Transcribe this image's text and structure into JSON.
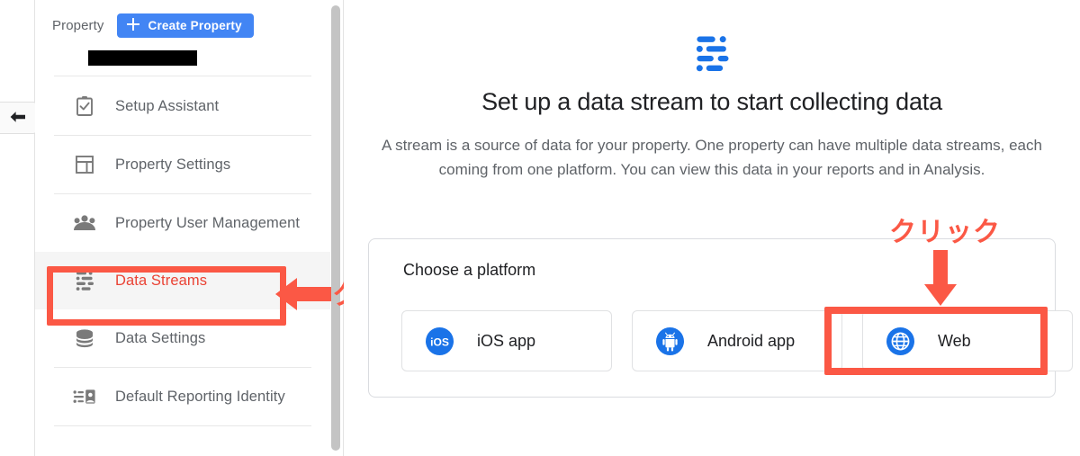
{
  "colors": {
    "brand_blue": "#4285f4",
    "icon_blue": "#1a73e8",
    "annotation_red": "#fb5845",
    "active_red": "#ea4335",
    "text_primary": "#202124",
    "text_secondary": "#5f6368"
  },
  "left_rail": {
    "collapse_icon": "back-arrow-icon"
  },
  "sidebar": {
    "section_label": "Property",
    "create_button": {
      "label": "Create Property",
      "icon": "plus-icon"
    },
    "property_name_redacted": "",
    "items": [
      {
        "label": "Setup Assistant",
        "icon": "clipboard-check-icon",
        "active": false
      },
      {
        "label": "Property Settings",
        "icon": "layout-panel-icon",
        "active": false
      },
      {
        "label": "Property User Management",
        "icon": "people-group-icon",
        "active": false
      },
      {
        "label": "Data Streams",
        "icon": "data-streams-icon",
        "active": true
      },
      {
        "label": "Data Settings",
        "icon": "database-stack-icon",
        "active": false
      },
      {
        "label": "Default Reporting Identity",
        "icon": "reporting-identity-icon",
        "active": false
      }
    ]
  },
  "main": {
    "hero_icon": "data-streams-icon",
    "title": "Set up a data stream to start collecting data",
    "description": "A stream is a source of data for your property. One property can have multiple data streams, each coming from one platform. You can view this data in your reports and in Analysis.",
    "platform_card": {
      "title": "Choose a platform",
      "options": [
        {
          "label": "iOS app",
          "icon": "ios-logo-icon"
        },
        {
          "label": "Android app",
          "icon": "android-logo-icon"
        },
        {
          "label": "Web",
          "icon": "globe-icon",
          "highlighted": true
        }
      ]
    }
  },
  "annotations": [
    {
      "text": "クリック",
      "target": "Data Streams",
      "arrow": "left-arrow-icon"
    },
    {
      "text": "クリック",
      "target": "Web",
      "arrow": "down-arrow-icon"
    }
  ]
}
